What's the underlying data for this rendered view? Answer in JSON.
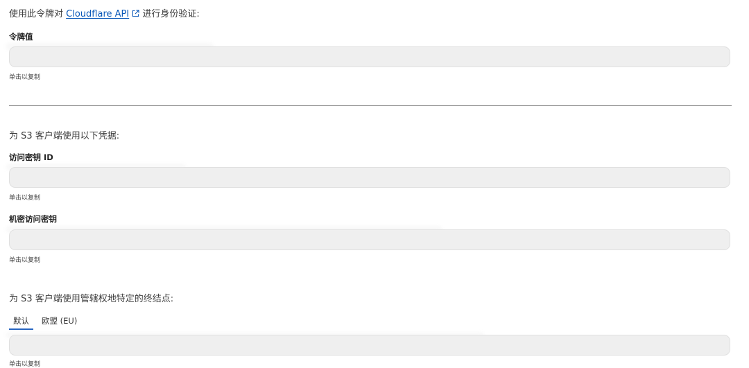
{
  "api_section": {
    "intro_prefix": "使用此令牌对",
    "intro_link": "Cloudflare API",
    "intro_suffix": "进行身份验证:",
    "token_label": "令牌值",
    "token_value": "",
    "token_hint": "单击以复制"
  },
  "s3_section": {
    "intro": "为 S3 客户端使用以下凭据:",
    "access_key_label": "访问密钥 ID",
    "access_key_value": "",
    "access_key_hint": "单击以复制",
    "secret_key_label": "机密访问密钥",
    "secret_key_value": "",
    "secret_key_hint": "单击以复制"
  },
  "endpoint_section": {
    "intro": "为 S3 客户端使用管辖权地特定的终结点:",
    "tabs": [
      {
        "label": "默认",
        "selected": true
      },
      {
        "label": "欧盟 (EU)",
        "selected": false
      }
    ],
    "endpoint_value": "",
    "endpoint_hint": "单击以复制"
  },
  "colors": {
    "link": "#0a58b8",
    "tab_underline": "#1e5fbf",
    "field_bg": "#efefef"
  },
  "icons": {
    "external_link": "external-link-icon"
  }
}
